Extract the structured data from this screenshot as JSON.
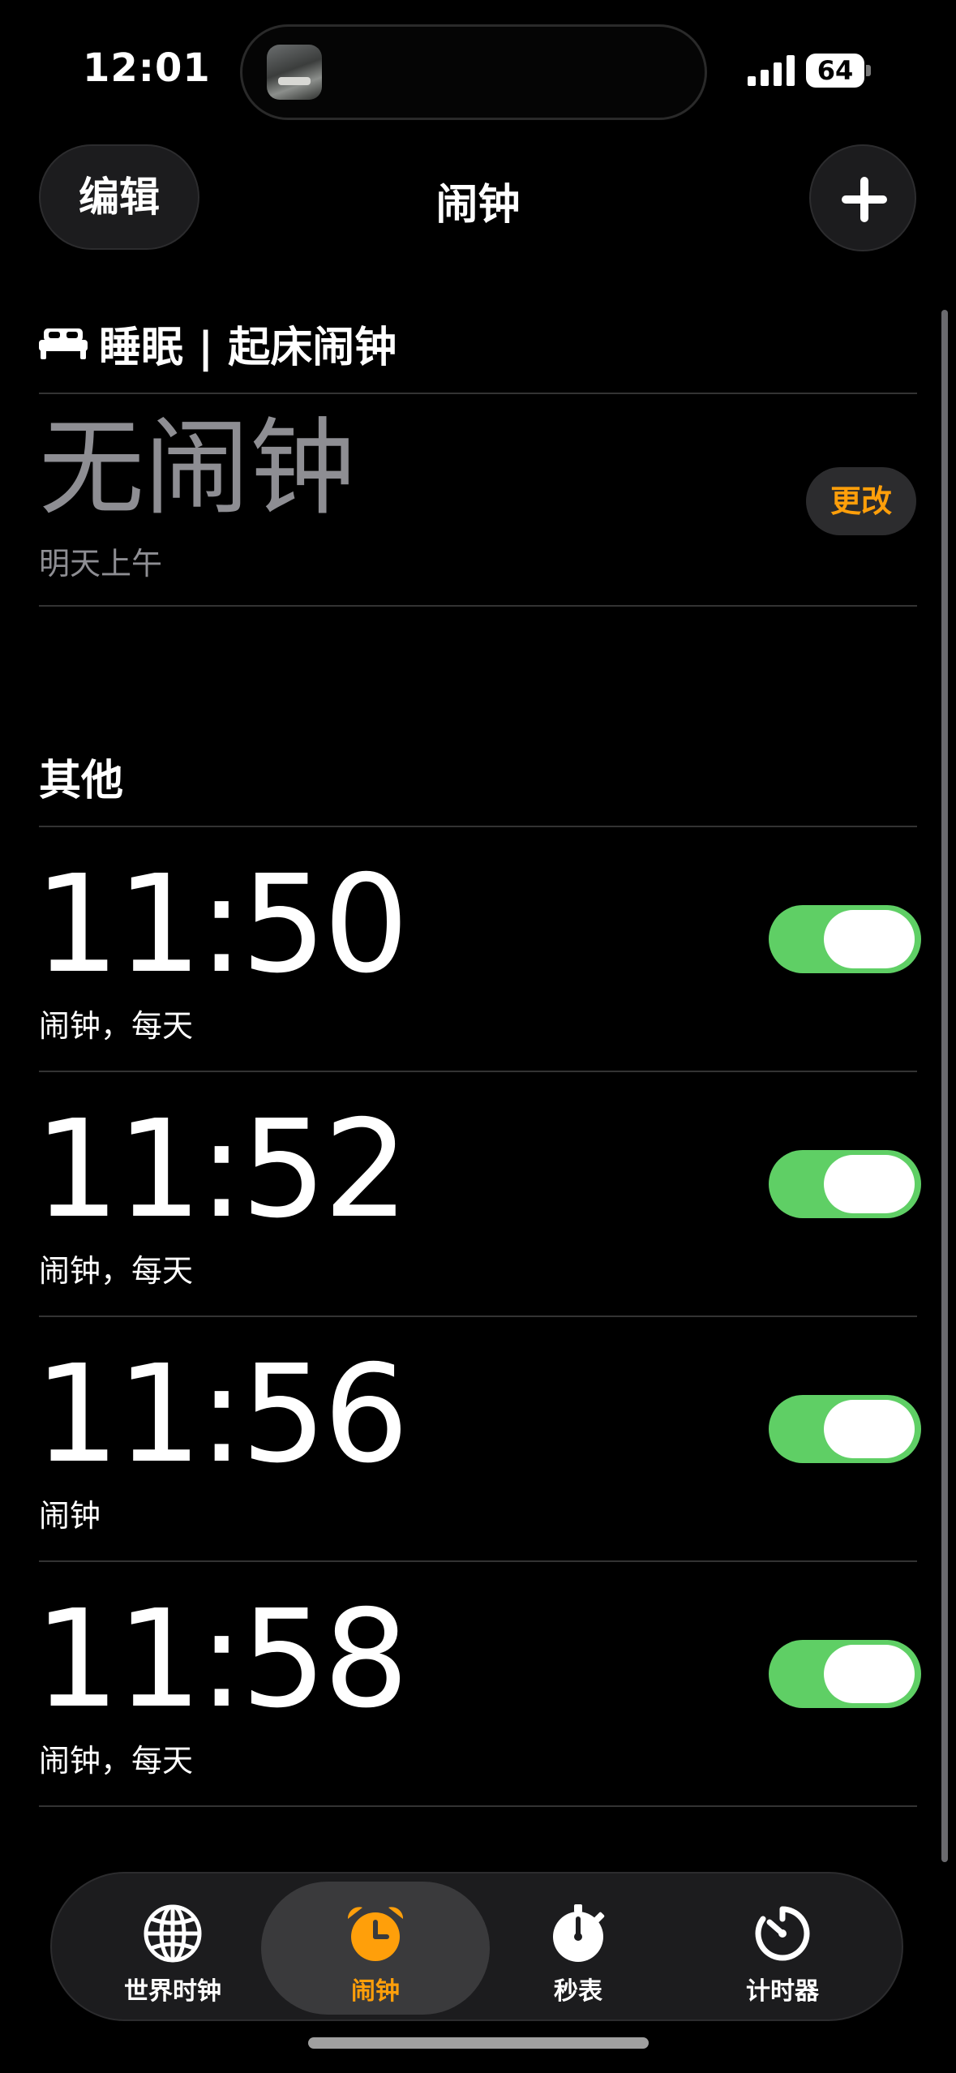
{
  "status_bar": {
    "time": "12:01",
    "battery": "64"
  },
  "nav": {
    "edit_label": "编辑",
    "title": "闹钟",
    "add_icon": "plus-icon"
  },
  "sleep": {
    "header": "睡眠 | 起床闹钟",
    "icon": "bed-icon",
    "status": "无闹钟",
    "subtitle": "明天上午",
    "change_label": "更改",
    "accent_color": "#ff9f0a"
  },
  "others": {
    "header": "其他",
    "alarms": [
      {
        "time": "11:50",
        "label": "闹钟，每天",
        "enabled": true
      },
      {
        "time": "11:52",
        "label": "闹钟，每天",
        "enabled": true
      },
      {
        "time": "11:56",
        "label": "闹钟",
        "enabled": true
      },
      {
        "time": "11:58",
        "label": "闹钟，每天",
        "enabled": true
      }
    ],
    "toggle_on_color": "#5fcf65"
  },
  "tabbar": {
    "tabs": [
      {
        "label": "世界时钟",
        "icon": "globe-icon",
        "active": false
      },
      {
        "label": "闹钟",
        "icon": "alarm-clock-icon",
        "active": true
      },
      {
        "label": "秒表",
        "icon": "stopwatch-icon",
        "active": false
      },
      {
        "label": "计时器",
        "icon": "timer-icon",
        "active": false
      }
    ]
  }
}
